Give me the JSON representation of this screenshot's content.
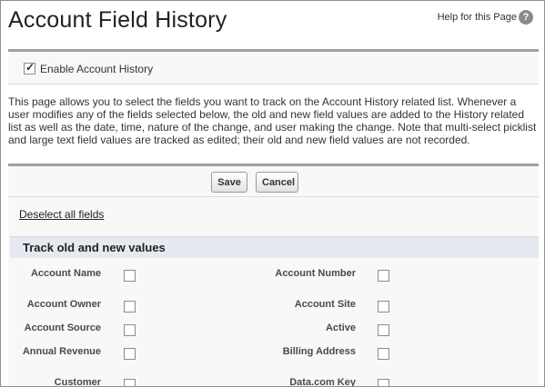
{
  "header": {
    "title": "Account Field History",
    "help_label": "Help for this Page",
    "help_icon": "?"
  },
  "enable": {
    "label": "Enable Account History",
    "checked": true
  },
  "description": "This page allows you to select the fields you want to track on the Account History related list. Whenever a user modifies any of the fields selected below, the old and new field values are added to the History related list as well as the date, time, nature of the change, and user making the change. Note that multi-select picklist and large text field values are tracked as edited; their old and new field values are not recorded.",
  "buttons": {
    "save": "Save",
    "cancel": "Cancel"
  },
  "deselect_label": "Deselect all fields",
  "section": {
    "title": "Track old and new values"
  },
  "fields_left": [
    {
      "label": "Account Name",
      "checked": false
    },
    {
      "label": "Account Owner",
      "checked": false
    },
    {
      "label": "Account Source",
      "checked": false
    },
    {
      "label": "Annual Revenue",
      "checked": false
    },
    {
      "label": "Customer",
      "checked": false
    }
  ],
  "fields_right": [
    {
      "label": "Account Number",
      "checked": false
    },
    {
      "label": "Account Site",
      "checked": false
    },
    {
      "label": "Active",
      "checked": false
    },
    {
      "label": "Billing Address",
      "checked": false
    },
    {
      "label": "Data.com Key",
      "checked": false
    }
  ]
}
